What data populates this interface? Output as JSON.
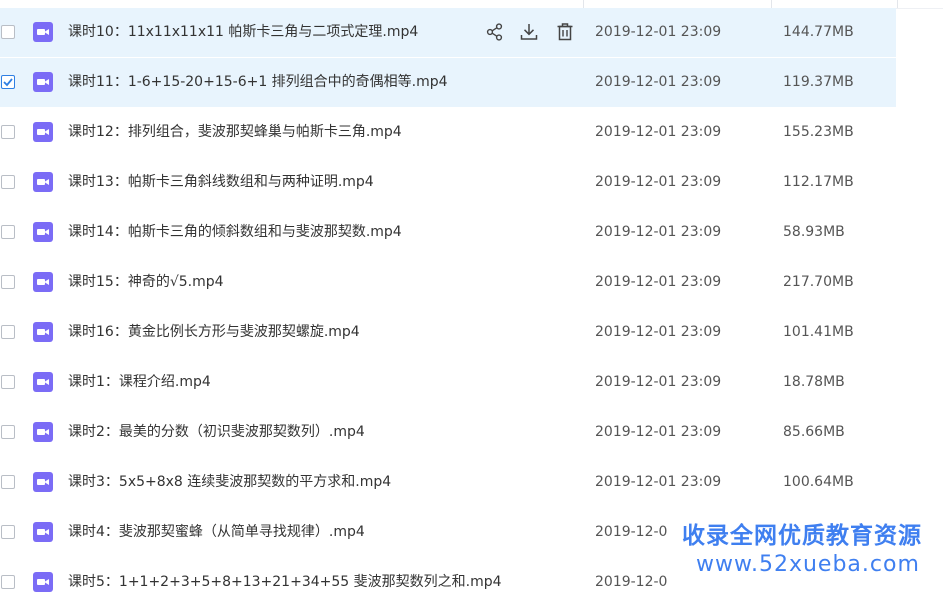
{
  "rows": [
    {
      "name": "课时10：11x11x11x11 帕斯卡三角与二项式定理.mp4",
      "date": "2019-12-01 23:09",
      "size": "144.77MB",
      "state": "hover",
      "checked": false
    },
    {
      "name": "课时11：1-6+15-20+15-6+1 排列组合中的奇偶相等.mp4",
      "date": "2019-12-01 23:09",
      "size": "119.37MB",
      "state": "selected",
      "checked": true
    },
    {
      "name": "课时12：排列组合，斐波那契蜂巢与帕斯卡三角.mp4",
      "date": "2019-12-01 23:09",
      "size": "155.23MB",
      "state": "",
      "checked": false
    },
    {
      "name": "课时13：帕斯卡三角斜线数组和与两种证明.mp4",
      "date": "2019-12-01 23:09",
      "size": "112.17MB",
      "state": "",
      "checked": false
    },
    {
      "name": "课时14：帕斯卡三角的倾斜数组和与斐波那契数.mp4",
      "date": "2019-12-01 23:09",
      "size": "58.93MB",
      "state": "",
      "checked": false
    },
    {
      "name": "课时15：神奇的√5.mp4",
      "date": "2019-12-01 23:09",
      "size": "217.70MB",
      "state": "",
      "checked": false
    },
    {
      "name": "课时16：黄金比例长方形与斐波那契螺旋.mp4",
      "date": "2019-12-01 23:09",
      "size": "101.41MB",
      "state": "",
      "checked": false
    },
    {
      "name": "课时1：课程介绍.mp4",
      "date": "2019-12-01 23:09",
      "size": "18.78MB",
      "state": "",
      "checked": false
    },
    {
      "name": "课时2：最美的分数（初识斐波那契数列）.mp4",
      "date": "2019-12-01 23:09",
      "size": "85.66MB",
      "state": "",
      "checked": false
    },
    {
      "name": "课时3：5x5+8x8 连续斐波那契数的平方求和.mp4",
      "date": "2019-12-01 23:09",
      "size": "100.64MB",
      "state": "",
      "checked": false
    },
    {
      "name": "课时4：斐波那契蜜蜂（从简单寻找规律）.mp4",
      "date": "2019-12-0",
      "size": "",
      "state": "",
      "checked": false
    },
    {
      "name": "课时5：1+1+2+3+5+8+13+21+34+55 斐波那契数列之和.mp4",
      "date": "2019-12-0",
      "size": "",
      "state": "",
      "checked": false
    }
  ],
  "actions": {
    "share_icon": "share-icon",
    "download_icon": "download-icon",
    "delete_icon": "trash-icon"
  },
  "watermark": {
    "line1": "收录全网优质教育资源",
    "line2": "www.52xueba.com"
  },
  "colors": {
    "row_highlight": "#e8f4fd",
    "video_icon": "#7b6cf6",
    "checkbox_checked": "#2f7fe3",
    "watermark": "#3f7ff0"
  }
}
